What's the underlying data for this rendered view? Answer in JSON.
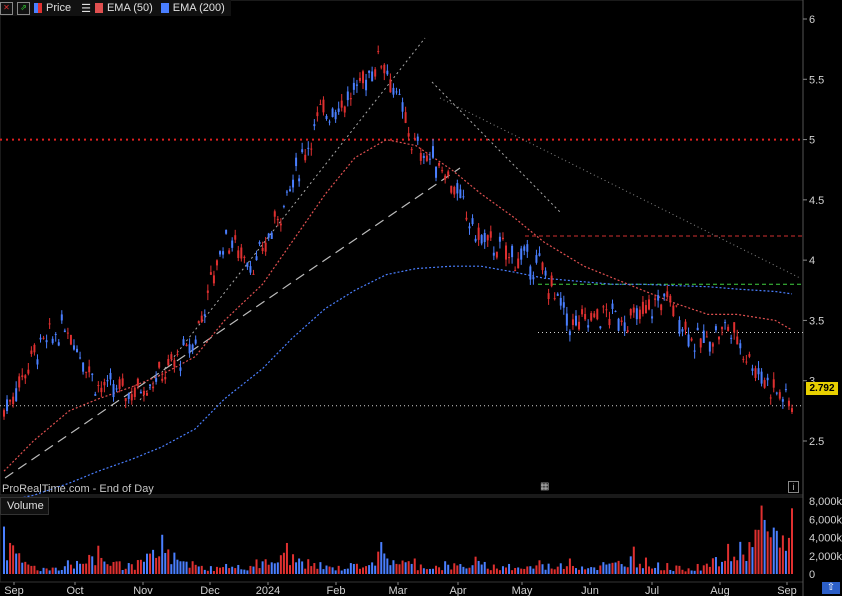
{
  "legend": {
    "price_label": "Price",
    "ema50_label": "EMA (50)",
    "ema200_label": "EMA (200)",
    "ema50_color": "#e05050",
    "ema200_color": "#4a7fff",
    "up_color": "#4a7fff",
    "down_color": "#e03030"
  },
  "source_text": "ProRealTime.com - End of Day",
  "volume_label": "Volume",
  "last_price": "2.792",
  "y_ticks": [
    "6",
    "5.5",
    "5",
    "4.5",
    "4",
    "3.5",
    "3",
    "2.5"
  ],
  "volume_ticks": [
    "8,000k",
    "6,000k",
    "4,000k",
    "2,000k",
    "0"
  ],
  "x_labels": [
    "Sep",
    "Oct",
    "Nov",
    "Dec",
    "2024",
    "Feb",
    "Mar",
    "Apr",
    "May",
    "Jun",
    "Jul",
    "Aug",
    "Sep"
  ],
  "chart_data": {
    "type": "line",
    "x": [
      "2023-09-01",
      "2023-09-15",
      "2023-10-02",
      "2023-10-16",
      "2023-11-01",
      "2023-11-15",
      "2023-12-01",
      "2023-12-15",
      "2024-01-02",
      "2024-01-16",
      "2024-02-01",
      "2024-02-15",
      "2024-03-01",
      "2024-03-15",
      "2024-04-01",
      "2024-04-15",
      "2024-05-01",
      "2024-05-15",
      "2024-06-03",
      "2024-06-17",
      "2024-07-01",
      "2024-07-15",
      "2024-08-01",
      "2024-08-15",
      "2024-09-02",
      "2024-09-10"
    ],
    "series": [
      {
        "name": "Price",
        "values": [
          2.75,
          3.25,
          3.45,
          2.95,
          2.9,
          3.05,
          3.3,
          4.2,
          3.95,
          4.55,
          5.2,
          5.35,
          5.7,
          4.95,
          4.75,
          4.2,
          4.05,
          3.95,
          3.45,
          3.55,
          3.5,
          3.7,
          3.3,
          3.45,
          3.05,
          2.792
        ]
      },
      {
        "name": "EMA (50)",
        "values": [
          2.25,
          2.5,
          2.75,
          2.85,
          2.95,
          3.05,
          3.2,
          3.5,
          3.8,
          4.15,
          4.55,
          4.85,
          5.0,
          4.95,
          4.75,
          4.55,
          4.35,
          4.15,
          3.95,
          3.85,
          3.75,
          3.65,
          3.55,
          3.55,
          3.5,
          3.42
        ]
      },
      {
        "name": "EMA (200)",
        "values": [
          2.0,
          2.05,
          2.15,
          2.25,
          2.35,
          2.45,
          2.6,
          2.85,
          3.1,
          3.35,
          3.6,
          3.75,
          3.88,
          3.93,
          3.95,
          3.95,
          3.9,
          3.85,
          3.82,
          3.8,
          3.8,
          3.79,
          3.78,
          3.76,
          3.74,
          3.72
        ]
      }
    ],
    "volume_k": [
      5200,
      900,
      1500,
      3100,
      1200,
      4300,
      1400,
      1100,
      1600,
      3400,
      1300,
      1200,
      3500,
      1700,
      1400,
      1900,
      1100,
      1500,
      1700,
      1300,
      3000,
      1200,
      1100,
      3300,
      7500,
      7200
    ],
    "horizontal_levels": [
      5.0,
      4.2,
      3.8,
      3.4,
      2.792
    ],
    "ylim": [
      2.1,
      6.1
    ],
    "volume_ylim": [
      0,
      8000
    ],
    "grid": false,
    "legend_position": "top-left"
  }
}
